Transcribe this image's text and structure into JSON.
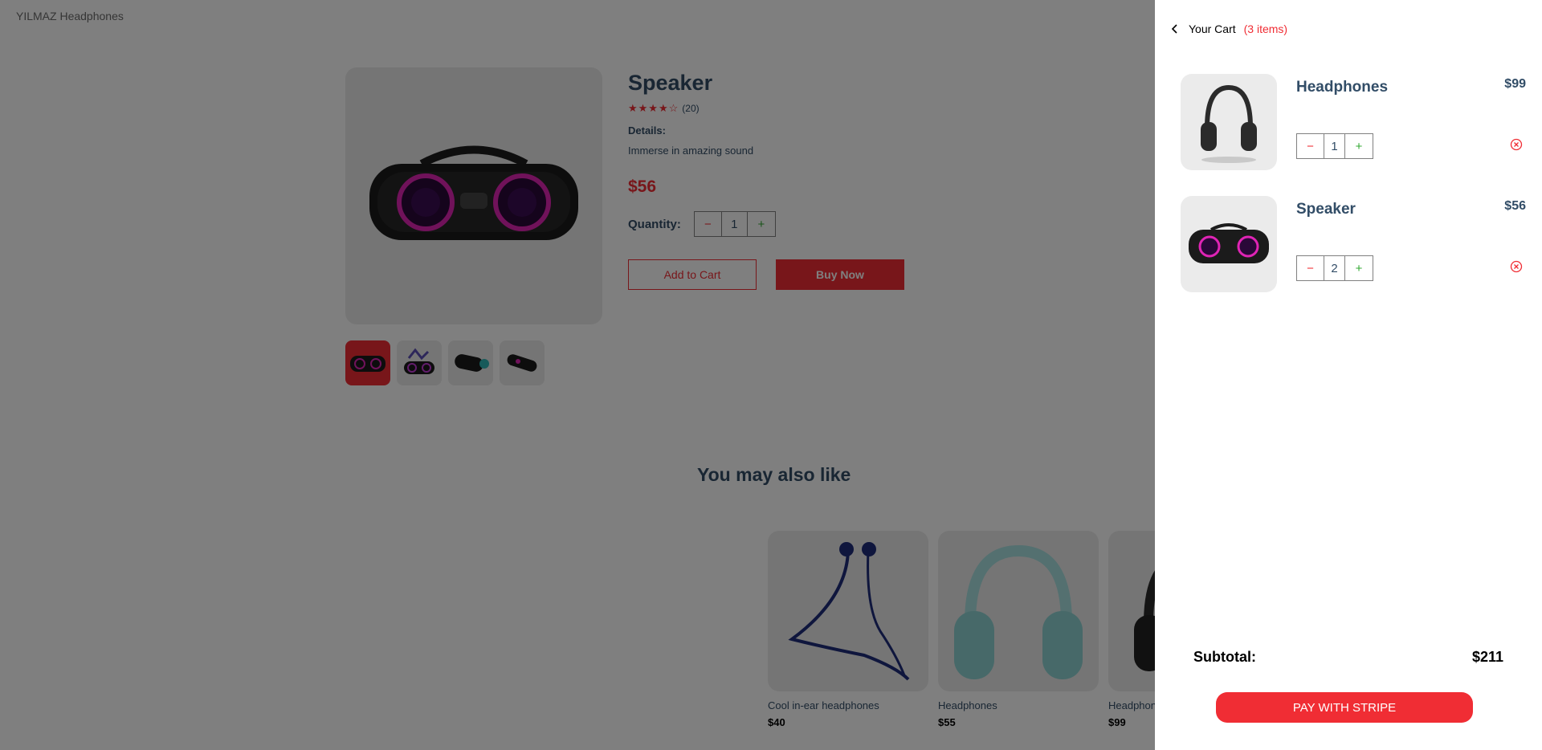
{
  "header": {
    "logo": "YILMAZ Headphones"
  },
  "product": {
    "title": "Speaker",
    "stars": "★★★★☆",
    "reviews": "(20)",
    "details_heading": "Details:",
    "details_text": "Immerse in amazing sound",
    "price": "$56",
    "quantity_label": "Quantity:",
    "quantity": "1",
    "minus": "−",
    "plus": "+",
    "add_to_cart": "Add to Cart",
    "buy_now": "Buy Now"
  },
  "also_like": {
    "title": "You may also like",
    "items": [
      {
        "name": "Cool in-ear headphones",
        "price": "$40"
      },
      {
        "name": "Headphones",
        "price": "$55"
      },
      {
        "name": "Headphones",
        "price": "$99"
      }
    ]
  },
  "cart": {
    "heading": "Your Cart",
    "count": "(3 items)",
    "items": [
      {
        "name": "Headphones",
        "price": "$99",
        "quantity": "1"
      },
      {
        "name": "Speaker",
        "price": "$56",
        "quantity": "2"
      }
    ],
    "subtotal_label": "Subtotal:",
    "subtotal_value": "$211",
    "pay_button": "PAY WITH STRIPE"
  },
  "colors": {
    "accent": "#f02d34",
    "text": "#324d67",
    "plus": "#31a831"
  },
  "icons": [
    "chevron-left-icon",
    "remove-circle-icon",
    "star-icon"
  ]
}
